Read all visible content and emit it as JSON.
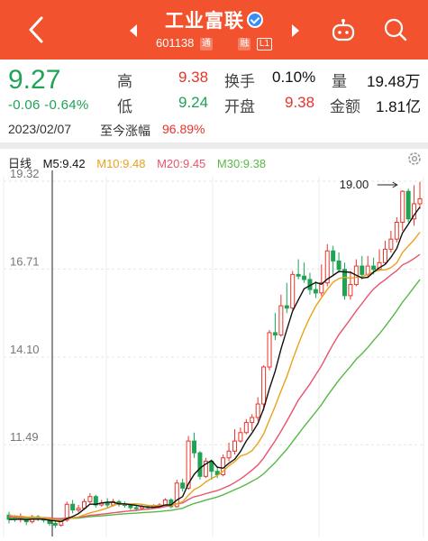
{
  "header": {
    "stock_name": "工业富联",
    "stock_code": "601138",
    "badge_tong": "通",
    "badge_rong": "融",
    "badge_level": "L1"
  },
  "quote": {
    "price": "9.27",
    "change": "-0.06",
    "change_pct": "-0.64%",
    "date": "2023/02/07",
    "since_label": "至今涨幅",
    "since_value": "96.89%",
    "high_label": "高",
    "high": "9.38",
    "low_label": "低",
    "low": "9.24",
    "turnover_label": "换手",
    "turnover": "0.10%",
    "open_label": "开盘",
    "open": "9.38",
    "volume_label": "量",
    "volume": "19.48万",
    "amount_label": "金额",
    "amount": "1.81亿"
  },
  "chart_legend": {
    "period": "日线",
    "ma5": "M5:9.42",
    "ma10": "M10:9.48",
    "ma20": "M20:9.45",
    "ma30": "M30:9.38"
  },
  "colors": {
    "header": "#f2522e",
    "up": "#e7352b",
    "down": "#1fa355",
    "ma5": "#111111",
    "ma10": "#e9a21b",
    "ma20": "#e8546e",
    "ma30": "#58b848"
  },
  "chart_data": {
    "type": "candlestick",
    "y_ticks": [
      "19.32",
      "16.71",
      "14.10",
      "11.49"
    ],
    "ylim": [
      8.87,
      19.32
    ],
    "max_marker": "19.00",
    "grid": true,
    "candles": [
      [
        9.4,
        9.27,
        9.5,
        9.15
      ],
      [
        9.33,
        9.27,
        9.4,
        9.2
      ],
      [
        9.27,
        9.3,
        9.45,
        9.18
      ],
      [
        9.3,
        9.2,
        9.35,
        9.1
      ],
      [
        9.2,
        9.35,
        9.4,
        9.15
      ],
      [
        9.35,
        9.28,
        9.4,
        9.22
      ],
      [
        9.28,
        9.25,
        9.33,
        9.18
      ],
      [
        9.25,
        9.15,
        9.3,
        9.08
      ],
      [
        9.15,
        9.1,
        9.22,
        9.02
      ],
      [
        9.1,
        9.25,
        9.3,
        9.05
      ],
      [
        9.25,
        9.72,
        9.8,
        9.2
      ],
      [
        9.72,
        9.55,
        9.85,
        9.45
      ],
      [
        9.55,
        9.6,
        9.7,
        9.48
      ],
      [
        9.6,
        9.8,
        9.88,
        9.55
      ],
      [
        9.8,
        9.95,
        10.05,
        9.75
      ],
      [
        9.95,
        9.7,
        10.0,
        9.62
      ],
      [
        9.7,
        9.75,
        9.85,
        9.65
      ],
      [
        9.75,
        9.7,
        9.9,
        9.6
      ],
      [
        9.7,
        9.8,
        9.88,
        9.65
      ],
      [
        9.8,
        9.72,
        9.85,
        9.65
      ],
      [
        9.72,
        9.7,
        9.8,
        9.62
      ],
      [
        9.7,
        9.62,
        9.75,
        9.55
      ],
      [
        9.62,
        9.6,
        9.7,
        9.52
      ],
      [
        9.6,
        9.65,
        9.72,
        9.55
      ],
      [
        9.65,
        9.62,
        9.7,
        9.55
      ],
      [
        9.62,
        9.68,
        9.72,
        9.58
      ],
      [
        9.68,
        9.7,
        9.75,
        9.62
      ],
      [
        9.7,
        9.85,
        9.9,
        9.65
      ],
      [
        9.85,
        9.65,
        9.9,
        9.6
      ],
      [
        9.65,
        10.35,
        10.45,
        9.62
      ],
      [
        10.35,
        10.2,
        10.48,
        10.1
      ],
      [
        10.2,
        11.6,
        11.75,
        10.15
      ],
      [
        11.6,
        11.25,
        11.85,
        11.1
      ],
      [
        11.25,
        10.55,
        11.3,
        10.45
      ],
      [
        10.55,
        11.0,
        11.1,
        10.5
      ],
      [
        11.0,
        10.7,
        11.05,
        10.45
      ],
      [
        10.7,
        10.6,
        10.85,
        10.5
      ],
      [
        10.6,
        11.1,
        11.2,
        10.55
      ],
      [
        11.1,
        11.3,
        11.55,
        11.0
      ],
      [
        11.3,
        11.6,
        11.95,
        11.2
      ],
      [
        11.6,
        11.85,
        12.0,
        11.55
      ],
      [
        11.85,
        12.15,
        12.25,
        11.8
      ],
      [
        12.15,
        12.3,
        12.4,
        11.9
      ],
      [
        12.3,
        12.7,
        12.9,
        12.2
      ],
      [
        12.7,
        13.8,
        13.85,
        12.5
      ],
      [
        13.8,
        14.82,
        14.9,
        13.7
      ],
      [
        14.82,
        14.75,
        15.4,
        14.6
      ],
      [
        14.75,
        15.62,
        15.95,
        14.7
      ],
      [
        15.62,
        15.55,
        16.3,
        15.4
      ],
      [
        15.55,
        16.55,
        16.65,
        15.5
      ],
      [
        16.55,
        16.5,
        17.0,
        16.4
      ],
      [
        16.5,
        16.4,
        16.9,
        16.3
      ],
      [
        16.4,
        16.1,
        16.6,
        15.95
      ],
      [
        16.1,
        16.0,
        16.35,
        15.85
      ],
      [
        16.0,
        16.3,
        16.85,
        15.9
      ],
      [
        16.3,
        17.25,
        17.45,
        16.2
      ],
      [
        17.25,
        16.95,
        17.4,
        16.5
      ],
      [
        16.95,
        16.7,
        17.2,
        16.6
      ],
      [
        16.7,
        15.92,
        16.9,
        15.8
      ],
      [
        15.92,
        16.25,
        16.65,
        15.8
      ],
      [
        16.25,
        16.8,
        17.0,
        16.2
      ],
      [
        16.8,
        16.55,
        17.1,
        16.4
      ],
      [
        16.55,
        16.8,
        17.1,
        16.45
      ],
      [
        16.8,
        16.7,
        17.05,
        16.55
      ],
      [
        16.7,
        16.9,
        17.3,
        16.65
      ],
      [
        16.9,
        17.3,
        17.55,
        16.85
      ],
      [
        17.3,
        17.6,
        17.85,
        17.2
      ],
      [
        17.6,
        18.1,
        18.25,
        17.5
      ],
      [
        18.1,
        19.02,
        19.05,
        17.85
      ],
      [
        19.02,
        18.2,
        19.1,
        18.1
      ],
      [
        18.2,
        18.65,
        19.2,
        18.0
      ],
      [
        18.65,
        18.8,
        19.3,
        18.5
      ]
    ]
  }
}
